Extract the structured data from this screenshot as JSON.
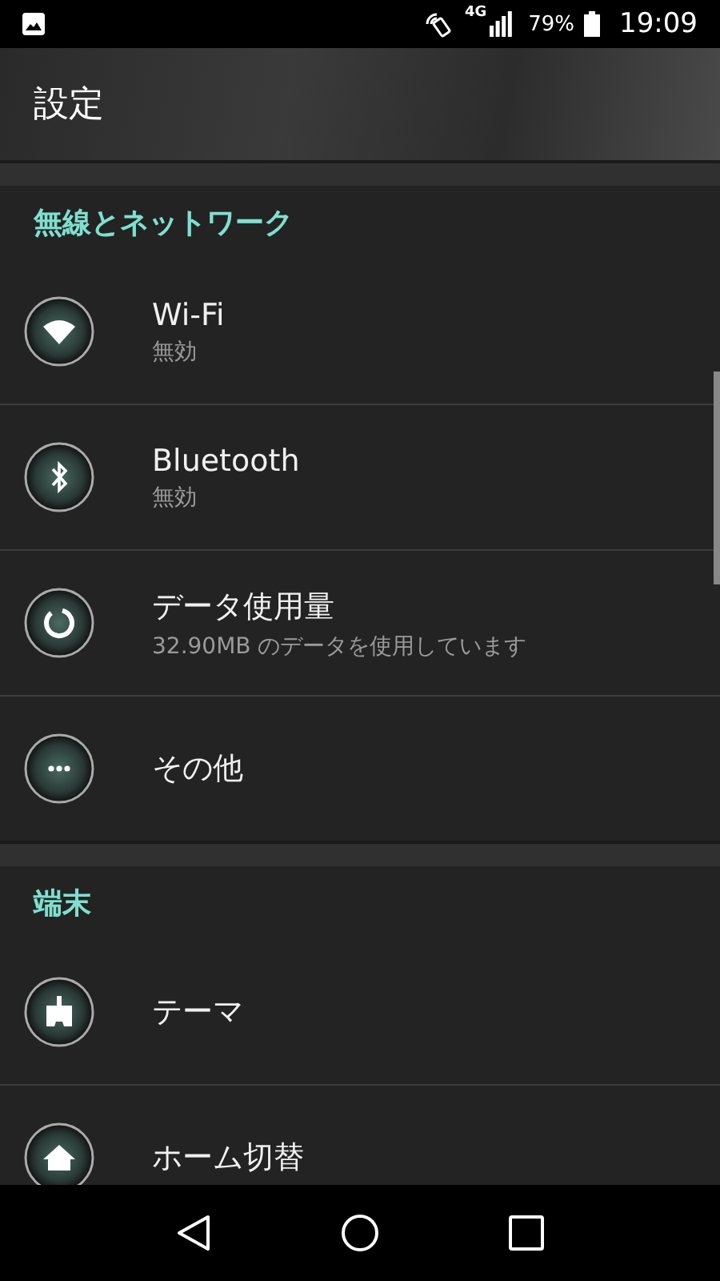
{
  "status_bar": {
    "network": "4G",
    "battery": "79%",
    "time": "19:09"
  },
  "header": {
    "title": "設定"
  },
  "sections": [
    {
      "title": "無線とネットワーク",
      "items": [
        {
          "title": "Wi-Fi",
          "subtitle": "無効"
        },
        {
          "title": "Bluetooth",
          "subtitle": "無効"
        },
        {
          "title": "データ使用量",
          "subtitle": "32.90MB のデータを使用しています"
        },
        {
          "title": "その他"
        }
      ]
    },
    {
      "title": "端末",
      "items": [
        {
          "title": "テーマ"
        },
        {
          "title": "ホーム切替"
        }
      ]
    }
  ]
}
